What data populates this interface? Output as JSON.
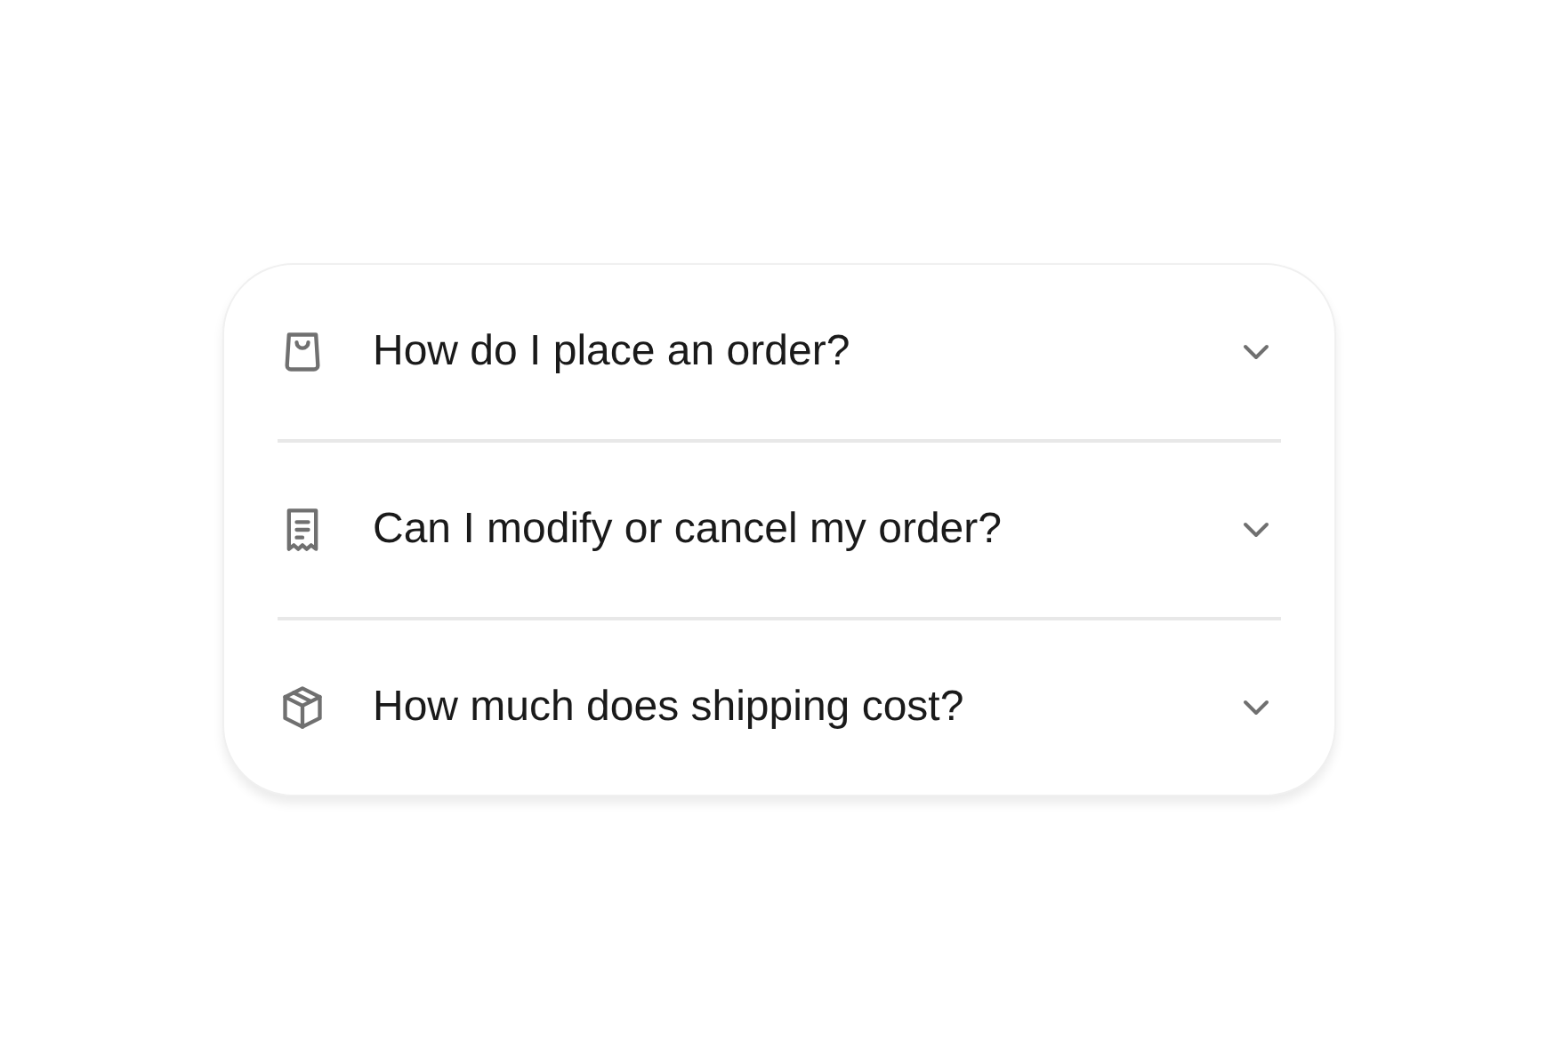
{
  "faq": [
    {
      "question": "How do I place an order?",
      "expanded": false
    },
    {
      "question": "Can I modify or cancel my order?",
      "expanded": false
    },
    {
      "question": "How much does shipping cost?",
      "expanded": false
    }
  ]
}
